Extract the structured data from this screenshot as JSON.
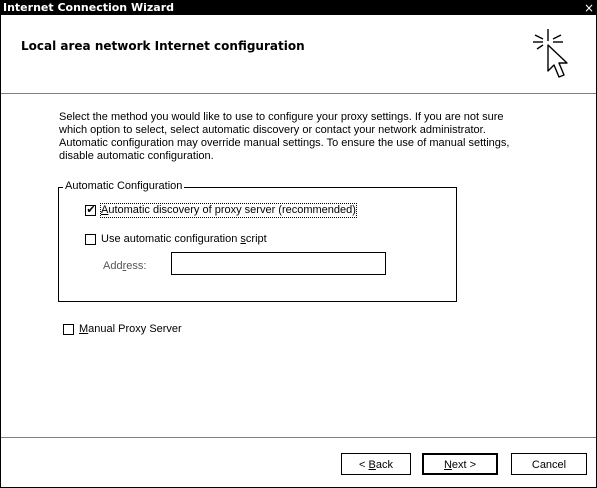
{
  "window": {
    "title": "Internet Connection Wizard",
    "close_glyph": "×"
  },
  "header": {
    "title": "Local area network Internet configuration",
    "icon": "pointer-cursor-icon"
  },
  "description": "Select the method you would like to use to configure your proxy settings.  If you are not sure which option to select, select automatic discovery or contact your network administrator.  Automatic configuration may override manual settings.  To ensure the use of manual settings, disable automatic configuration.",
  "auto_config": {
    "group_label": "Automatic Configuration",
    "auto_discovery": {
      "mnemonic": "A",
      "rest": "utomatic discovery of proxy server (recommended)",
      "checked": true
    },
    "config_script": {
      "before": "Use automatic configuration ",
      "mnemonic": "s",
      "after": "cript",
      "checked": false
    },
    "address": {
      "before": "Add",
      "mnemonic": "r",
      "after": "ess:",
      "value": ""
    }
  },
  "manual_proxy": {
    "mnemonic": "M",
    "rest": "anual Proxy Server",
    "checked": false
  },
  "buttons": {
    "back": {
      "prefix": "< ",
      "mnemonic": "B",
      "rest": "ack"
    },
    "next": {
      "mnemonic": "N",
      "rest": "ext >"
    },
    "cancel": "Cancel"
  }
}
